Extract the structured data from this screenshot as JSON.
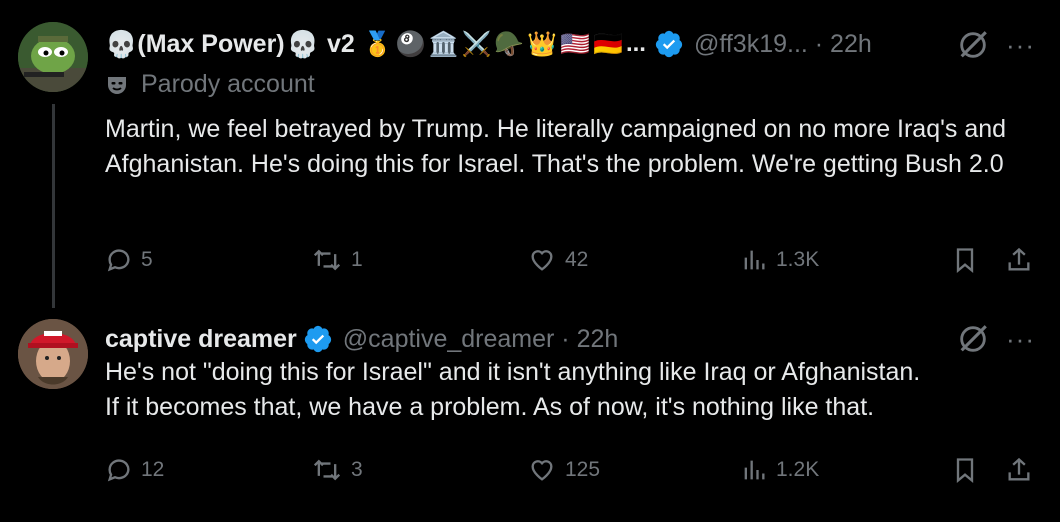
{
  "tweets": [
    {
      "name": "(Max Power)",
      "name_suffix": "v2",
      "badges": [
        "🥇",
        "🎱",
        "🏛️",
        "⚔️",
        "🪖",
        "👑",
        "🇺🇸",
        "🇩🇪"
      ],
      "badges_more": "...",
      "handle": "@ff3k19... · 22h",
      "parody_label": "Parody account",
      "text": "Martin, we feel betrayed by Trump. He literally campaigned on no more Iraq's and Afghanistan. He's doing this for Israel. That's the problem. We're getting Bush 2.0",
      "replies": "5",
      "reposts": "1",
      "likes": "42",
      "views": "1.3K"
    },
    {
      "name": "captive dreamer",
      "handle": "@captive_dreamer · 22h",
      "text_line1": "He's not \"doing this for Israel\" and it isn't anything like Iraq or Afghanistan.",
      "text_line2": "If it becomes that, we have a problem.  As of now, it's nothing like that.",
      "replies": "12",
      "reposts": "3",
      "likes": "125",
      "views": "1.2K"
    }
  ],
  "colors": {
    "background": "#000000",
    "text": "#e7e9ea",
    "muted": "#71767b",
    "verified": "#1d9bf0",
    "thread_line": "#333639"
  },
  "more_label": "···",
  "skull_glyph": "💀"
}
